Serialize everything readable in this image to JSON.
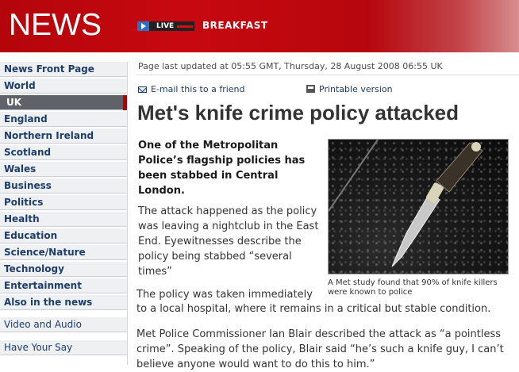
{
  "header": {
    "logo": "NEWS",
    "live_label": "LIVE",
    "programme": "BREAKFAST",
    "colors": {
      "brand_red": "#c80810",
      "live_play": "#2a6fc9"
    }
  },
  "sidebar": {
    "items": [
      {
        "label": "News Front Page",
        "style": "bold"
      },
      {
        "label": "World",
        "style": "bold"
      },
      {
        "label": "UK",
        "style": "active"
      },
      {
        "label": "England",
        "style": "bold"
      },
      {
        "label": "Northern Ireland",
        "style": "bold"
      },
      {
        "label": "Scotland",
        "style": "bold"
      },
      {
        "label": "Wales",
        "style": "bold"
      },
      {
        "label": "Business",
        "style": "bold"
      },
      {
        "label": "Politics",
        "style": "bold"
      },
      {
        "label": "Health",
        "style": "bold"
      },
      {
        "label": "Education",
        "style": "bold"
      },
      {
        "label": "Science/Nature",
        "style": "bold"
      },
      {
        "label": "Technology",
        "style": "bold"
      },
      {
        "label": "Entertainment",
        "style": "bold"
      },
      {
        "label": "Also in the news",
        "style": "bold"
      },
      {
        "label": "Video and Audio",
        "style": "light"
      },
      {
        "label": "Have Your Say",
        "style": "light2"
      }
    ]
  },
  "article": {
    "updated": "Page last updated at 05:55 GMT, Thursday, 28 August 2008 06:55 UK",
    "email_link": "E-mail this to a friend",
    "email_icon": "envelope-icon",
    "print_link": "Printable version",
    "print_icon": "printer-icon",
    "headline": "Met's knife crime policy attacked",
    "intro": "One of the Metropolitan Police’s flagship policies has been stabbed in Central London.",
    "para1": "The attack happened as the policy was leaving a nightclub in the East End. Eyewitnesses describe the policy being stabbed “several times”",
    "para2_line1": "The policy was taken immediately",
    "para2_line2": "to a local hospital, where it remains in a critical but stable condition.",
    "para3": "Met Police Commissioner Ian Blair described the attack as “a pointless crime”. Speaking of the policy, Blair said “he’s such a knife guy, I can’t believe anyone would want to do this to him.”",
    "photo_caption": "A Met study found that 90% of knife killers were known to police"
  }
}
